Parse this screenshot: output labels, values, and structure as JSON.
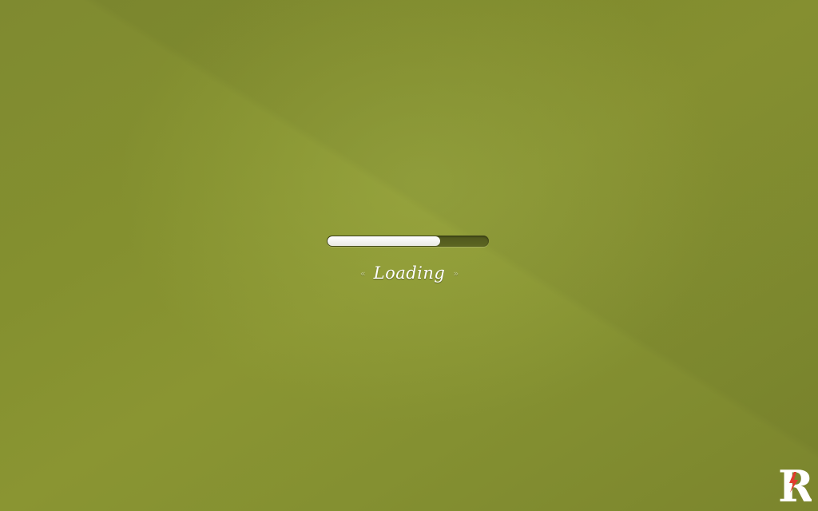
{
  "loader": {
    "progress": 0.7,
    "label": "Loading",
    "left_chevron": "«",
    "right_chevron": "»"
  },
  "brand": {
    "logo_letter": "R",
    "icon": "lightning-bolt-icon",
    "accent_color": "#e23b2e"
  },
  "colors": {
    "background": "#8a9532",
    "track": "#525a1f",
    "fill": "#ffffff"
  }
}
